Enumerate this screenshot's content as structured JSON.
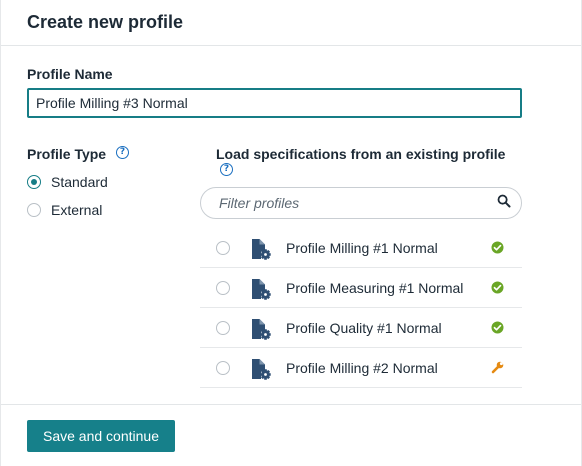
{
  "dialog": {
    "title": "Create new profile",
    "save_label": "Save and continue"
  },
  "profile_name": {
    "label": "Profile Name",
    "value": "Profile Milling #3 Normal"
  },
  "profile_type": {
    "label": "Profile Type",
    "help_icon": "?",
    "options": [
      {
        "label": "Standard",
        "selected": true
      },
      {
        "label": "External",
        "selected": false
      }
    ]
  },
  "load_specs": {
    "label": "Load specifications from an existing profile",
    "help_icon": "?",
    "filter_placeholder": "Filter profiles",
    "profiles": [
      {
        "name": "Profile Milling #1 Normal",
        "status": "check-circle-icon"
      },
      {
        "name": "Profile Measuring #1 Normal",
        "status": "check-circle-icon"
      },
      {
        "name": "Profile Quality #1 Normal",
        "status": "check-circle-icon"
      },
      {
        "name": "Profile Milling #2 Normal",
        "status": "wrench-icon"
      }
    ]
  },
  "colors": {
    "accent": "#16808a",
    "check": "#6aa626",
    "wrench": "#e58a12",
    "doc_icon": "#2f4f73",
    "help": "#1a6fc0"
  }
}
